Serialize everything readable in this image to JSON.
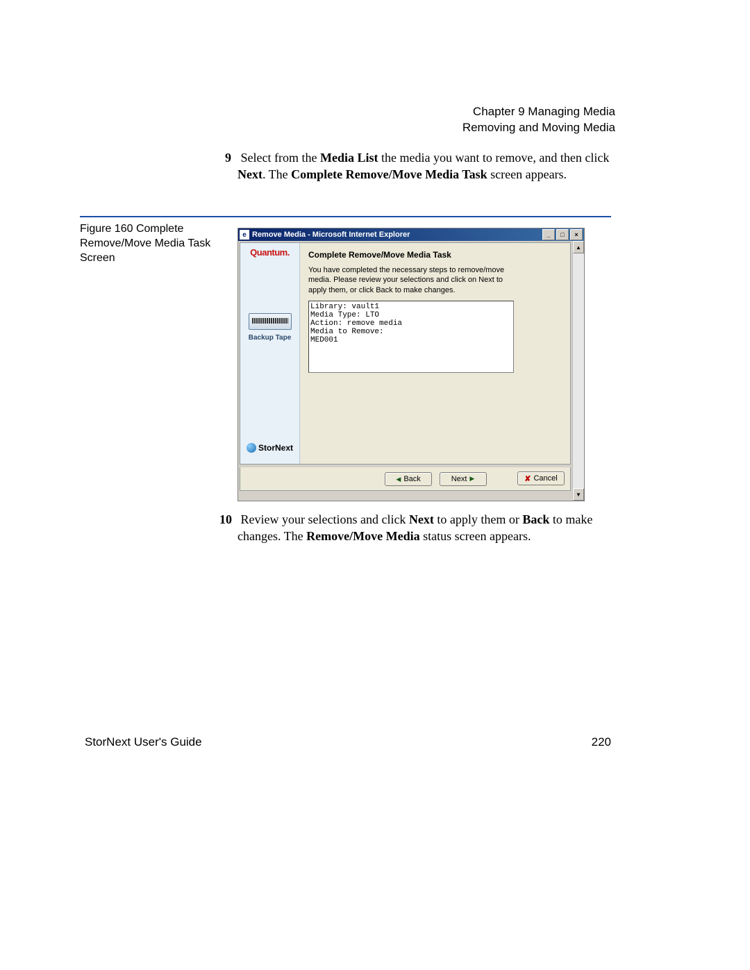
{
  "header": {
    "line1": "Chapter 9  Managing Media",
    "line2": "Removing and Moving Media"
  },
  "step9": {
    "num": "9",
    "prefix": "Select from the ",
    "bold1": "Media List",
    "mid1": " the media you want to remove, and then click ",
    "bold2": "Next",
    "mid2": ". The ",
    "bold3": "Complete Remove/Move Media Task",
    "suffix": " screen appears."
  },
  "figure": {
    "caption": "Figure 160  Complete Remove/Move Media Task Screen"
  },
  "window": {
    "title": "Remove Media - Microsoft Internet Explorer",
    "sidebar": {
      "brand": "Quantum.",
      "tape_label": "Backup Tape",
      "product": "StorNext"
    },
    "heading": "Complete Remove/Move Media Task",
    "instructions": "You have completed the necessary steps to remove/move media. Please review your selections and click on Next to apply them, or click Back to make changes.",
    "summary": "Library: vault1\nMedia Type: LTO\nAction: remove media\nMedia to Remove:\nMED001",
    "buttons": {
      "back": "Back",
      "next": "Next",
      "cancel": "Cancel"
    }
  },
  "step10": {
    "num": "10",
    "prefix": "Review your selections and click ",
    "bold1": "Next",
    "mid1": " to apply them or ",
    "bold2": "Back",
    "mid2": " to make changes. The ",
    "bold3": "Remove/Move Media",
    "suffix": " status screen appears."
  },
  "footer": {
    "left": "StorNext User's Guide",
    "right": "220"
  }
}
